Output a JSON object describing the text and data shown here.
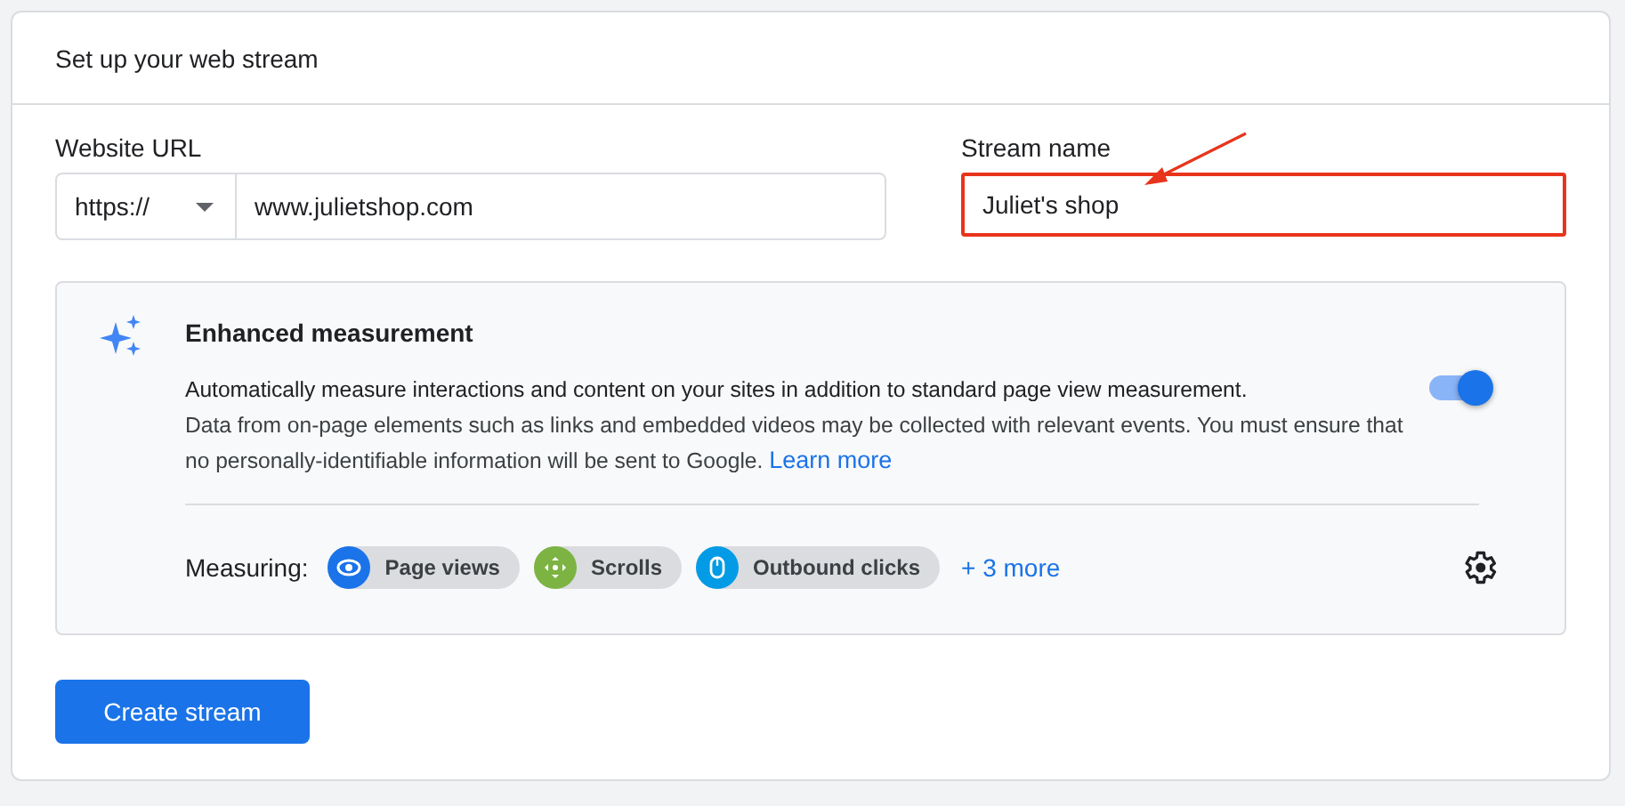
{
  "card": {
    "title": "Set up your web stream"
  },
  "website_url": {
    "label": "Website URL",
    "protocol": "https://",
    "value": "www.julietshop.com"
  },
  "stream_name": {
    "label": "Stream name",
    "value": "Juliet's shop",
    "highlighted": true
  },
  "enhanced_measurement": {
    "title": "Enhanced measurement",
    "on": true,
    "summary": "Automatically measure interactions and content on your sites in addition to standard page view measurement.",
    "details": "Data from on-page elements such as links and embedded videos may be collected with relevant events. You must ensure that no personally-identifiable information will be sent to Google.",
    "link": "Learn more",
    "measuring_label": "Measuring:",
    "chips": [
      {
        "label": "Page views",
        "kind": "eye",
        "color": "#1a73e8"
      },
      {
        "label": "Scrolls",
        "kind": "move",
        "color": "#7cb342"
      },
      {
        "label": "Outbound clicks",
        "kind": "mouse",
        "color": "#039be5"
      }
    ],
    "more": "+ 3 more"
  },
  "button": "Create stream"
}
